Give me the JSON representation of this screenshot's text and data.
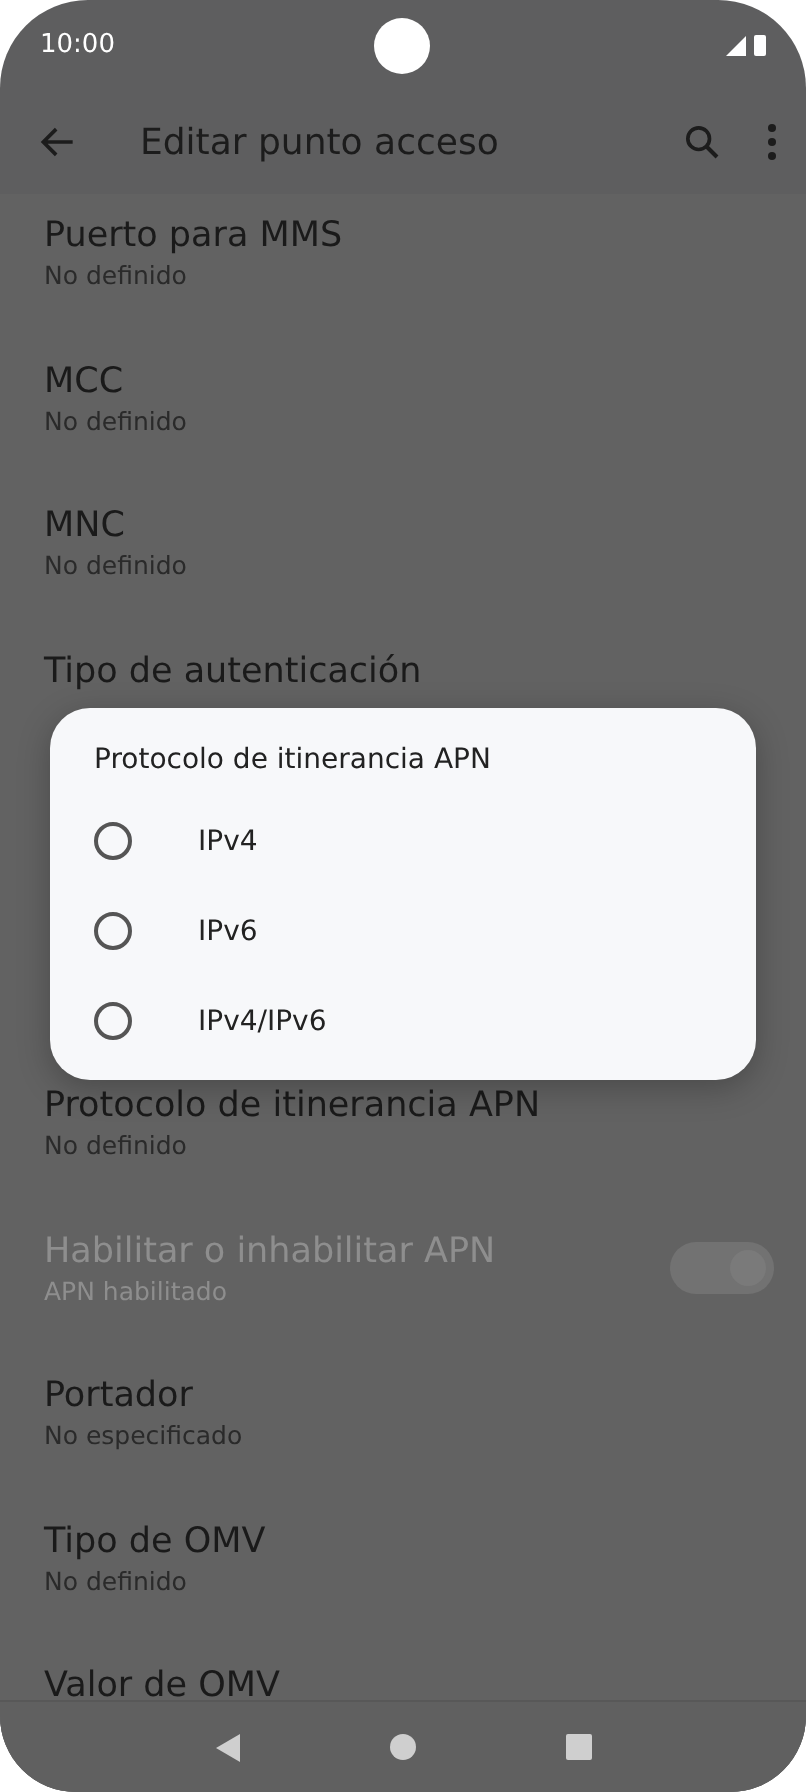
{
  "status_bar": {
    "time": "10:00"
  },
  "app_bar": {
    "title": "Editar punto acceso"
  },
  "settings": [
    {
      "title": "Puerto para MMS",
      "summary": "No definido",
      "disabled": false
    },
    {
      "title": "MCC",
      "summary": "No definido",
      "disabled": false
    },
    {
      "title": "MNC",
      "summary": "No definido",
      "disabled": false
    },
    {
      "title": "Tipo de autenticación",
      "disabled": false
    },
    {
      "kind": "hidden"
    },
    {
      "kind": "hidden"
    },
    {
      "title": "Protocolo de itinerancia APN",
      "summary": "No definido",
      "disabled": false
    },
    {
      "kind": "switch",
      "title": "Habilitar o inhabilitar APN",
      "summary": "APN habilitado",
      "disabled": true,
      "on": true
    },
    {
      "title": "Portador",
      "summary": "No especificado",
      "disabled": false
    },
    {
      "title": "Tipo de OMV",
      "summary": "No definido",
      "disabled": false
    },
    {
      "title": "Valor de OMV",
      "disabled": false
    }
  ],
  "dialog": {
    "title": "Protocolo de itinerancia APN",
    "options": [
      {
        "label": "IPv4",
        "selected": false
      },
      {
        "label": "IPv6",
        "selected": false
      },
      {
        "label": "IPv4/IPv6",
        "selected": false
      }
    ]
  }
}
